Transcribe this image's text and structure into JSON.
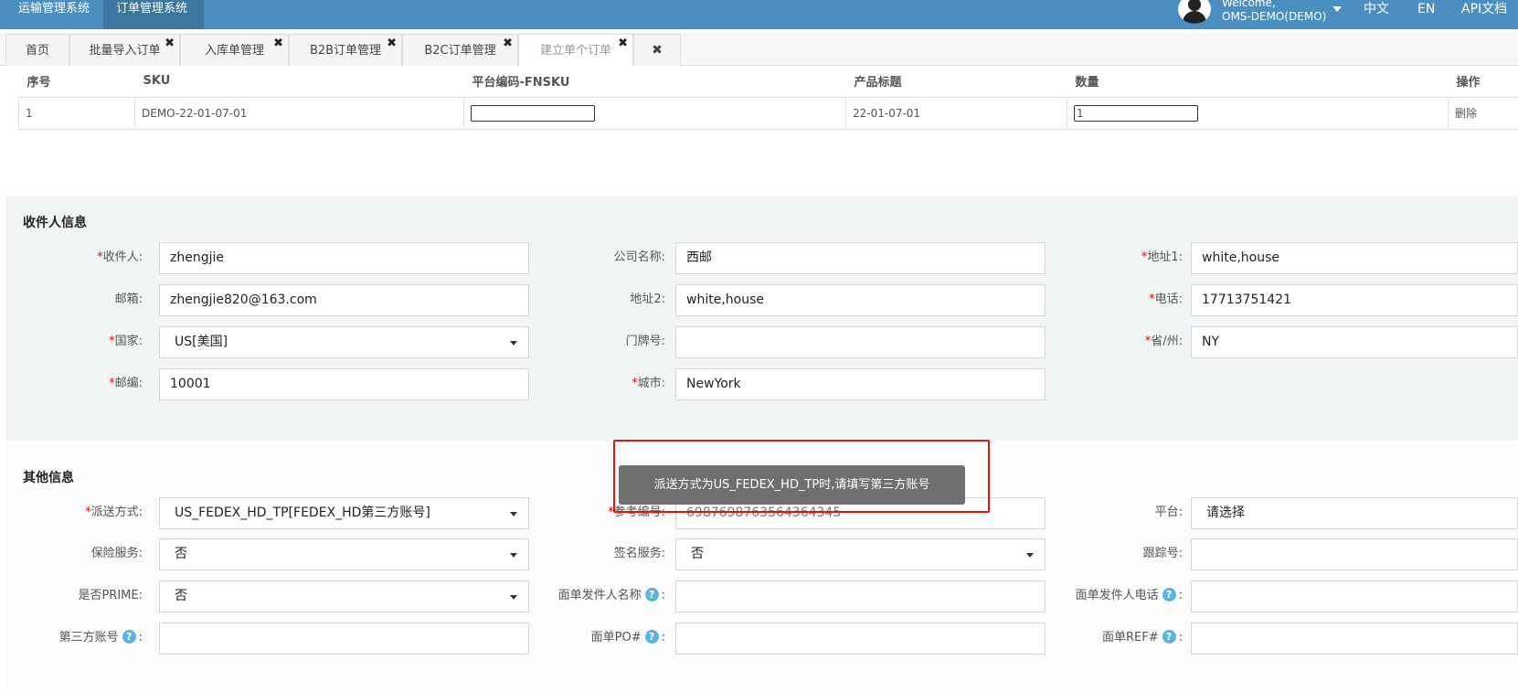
{
  "topbar": {
    "systems": [
      "运输管理系统",
      "订单管理系统"
    ],
    "welcome": "Welcome,",
    "user": "OMS-DEMO(DEMO)",
    "lang_zh": "中文",
    "lang_en": "EN",
    "api_docs": "API文档"
  },
  "tabs": [
    {
      "label": "首页"
    },
    {
      "label": "批量导入订单"
    },
    {
      "label": "入库单管理"
    },
    {
      "label": "B2B订单管理"
    },
    {
      "label": "B2C订单管理"
    },
    {
      "label": "建立单个订单"
    }
  ],
  "tab_close_glyph": "✖",
  "items_table": {
    "headers": [
      "序号",
      "SKU",
      "平台编码-FNSKU",
      "产品标题",
      "数量",
      "操作"
    ],
    "rows": [
      {
        "index": "1",
        "sku": "DEMO-22-01-07-01",
        "fnsku": "",
        "title": "22-01-07-01",
        "qty": "1",
        "action": "删除"
      }
    ]
  },
  "recipient": {
    "title": "收件人信息",
    "fields": {
      "name": {
        "label": "收件人:",
        "value": "zhengjie"
      },
      "company": {
        "label": "公司名称:",
        "value": "西邮"
      },
      "address1": {
        "label": "地址1:",
        "value": "white,house"
      },
      "email": {
        "label": "邮箱:",
        "value": "zhengjie820@163.com"
      },
      "address2": {
        "label": "地址2:",
        "value": "white,house"
      },
      "phone": {
        "label": "电话:",
        "value": "17713751421"
      },
      "country": {
        "label": "国家:",
        "value": "US[美国]"
      },
      "door": {
        "label": "门牌号:",
        "value": ""
      },
      "state": {
        "label": "省/州:",
        "value": "NY"
      },
      "zip": {
        "label": "邮编:",
        "value": "10001"
      },
      "city": {
        "label": "城市:",
        "value": "NewYork"
      }
    }
  },
  "other": {
    "title": "其他信息",
    "fields": {
      "shipping": {
        "label": "派送方式:",
        "value": "US_FEDEX_HD_TP[FEDEX_HD第三方账号]"
      },
      "reference": {
        "label": "参考编号:",
        "value": "6987698763564364345"
      },
      "platform": {
        "label": "平台:",
        "value": "请选择"
      },
      "insurance": {
        "label": "保险服务:",
        "value": "否"
      },
      "signature": {
        "label": "签名服务:",
        "value": "否"
      },
      "tracking": {
        "label": "跟踪号:",
        "value": ""
      },
      "prime": {
        "label": "是否PRIME:",
        "value": "否"
      },
      "sender_name": {
        "label": "面单发件人名称",
        "value": ""
      },
      "sender_phone": {
        "label": "面单发件人电话",
        "value": ""
      },
      "third_party": {
        "label": "第三方账号",
        "value": ""
      },
      "label_po": {
        "label": "面单PO#",
        "value": ""
      },
      "label_ref": {
        "label": "面单REF#",
        "value": ""
      }
    }
  },
  "help_glyph": "?",
  "colon": ":",
  "toast": "派送方式为US_FEDEX_HD_TP时,请填写第三方账号",
  "colors": {
    "topbar": "#4a8fc0",
    "active_system": "#3d77a0",
    "required": "#e00000",
    "toast_bg": "#6f6f6f",
    "highlight_box": "#e81010"
  }
}
